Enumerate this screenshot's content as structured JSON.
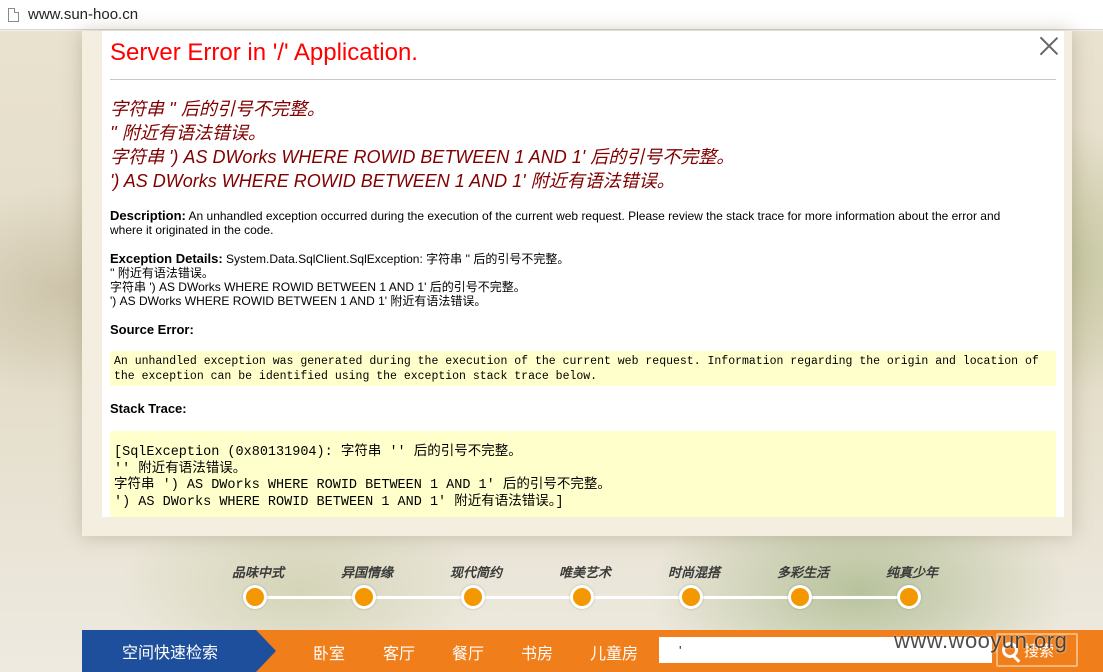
{
  "browser": {
    "url": "www.sun-hoo.cn"
  },
  "error": {
    "title": "Server Error in '/' Application.",
    "messages": [
      "字符串 '' 后的引号不完整。",
      "'' 附近有语法错误。",
      "字符串 ') AS DWorks WHERE ROWID BETWEEN 1 AND 1' 后的引号不完整。",
      "') AS DWorks WHERE ROWID BETWEEN 1 AND 1' 附近有语法错误。"
    ],
    "description_label": "Description:",
    "description_text": "An unhandled exception occurred during the execution of the current web request. Please review the stack trace for more information about the error and where it originated in the code.",
    "exception_label": "Exception Details:",
    "exception_lines": [
      "System.Data.SqlClient.SqlException: 字符串 '' 后的引号不完整。",
      "'' 附近有语法错误。",
      "字符串 ') AS DWorks WHERE ROWID BETWEEN 1 AND 1' 后的引号不完整。",
      "') AS DWorks WHERE ROWID BETWEEN 1 AND 1' 附近有语法错误。"
    ],
    "source_error_label": "Source Error:",
    "source_error_text": "An unhandled exception was generated during the execution of the current web request. Information regarding the origin and location of the exception can be identified using the exception stack trace below.",
    "stack_trace_label": "Stack Trace:",
    "stack_trace_lines": [
      "[SqlException (0x80131904): 字符串 '' 后的引号不完整。",
      "'' 附近有语法错误。",
      "字符串 ') AS DWorks WHERE ROWID BETWEEN 1 AND 1' 后的引号不完整。",
      "') AS DWorks WHERE ROWID BETWEEN 1 AND 1' 附近有语法错误。]"
    ]
  },
  "styles": {
    "categories": [
      "品味中式",
      "异国情缘",
      "现代简约",
      "唯美艺术",
      "时尚混搭",
      "多彩生活",
      "纯真少年"
    ]
  },
  "bottom_bar": {
    "quick_search": "空间快速检索",
    "rooms": [
      "卧室",
      "客厅",
      "餐厅",
      "书房",
      "儿童房"
    ],
    "search_value": "'",
    "search_button": "搜索"
  },
  "watermark": "www.wooyun.org",
  "colors": {
    "error_title": "#ff0000",
    "error_message": "#800000",
    "code_box": "#ffffcc",
    "accent_orange": "#f07e1a",
    "nav_blue": "#1e4f9c"
  }
}
